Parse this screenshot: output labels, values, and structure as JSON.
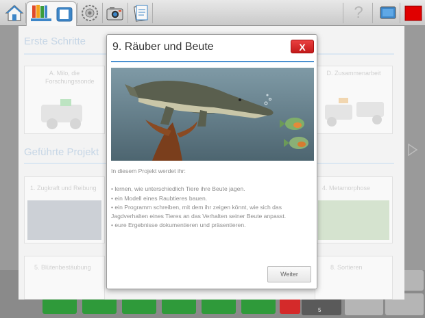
{
  "toolbar": {
    "home_icon": "home-icon",
    "projects_icon": "projects-books-icon",
    "settings_icon": "gear-icon",
    "camera_icon": "camera-icon",
    "document_icon": "document-icon",
    "help_label": "?",
    "screen_icon": "screen-icon",
    "record_icon": "record-icon"
  },
  "background": {
    "section1_title": "Erste Schritte",
    "section2_title": "Geführte Projekt",
    "cards": [
      {
        "label": "A. Milo, die Forschungssonde"
      },
      {
        "label": "D. Zusammenarbeit"
      },
      {
        "label": "1. Zugkraft und Reibung"
      },
      {
        "label": "4. Metamorphose"
      },
      {
        "label": "5. Blütenbestäubung"
      },
      {
        "label": "8. Sortieren"
      }
    ],
    "bottom_counter": "5"
  },
  "modal": {
    "title": "9. Räuber und Beute",
    "close_label": "X",
    "intro": "In diesem Projekt werdet ihr:",
    "bullets": [
      "• lernen, wie unterschiedlich Tiere ihre Beute jagen.",
      "• ein Modell eines Raubtieres bauen.",
      "• ein Programm schreiben, mit dem ihr zeigen könnt, wie sich das Jagdverhalten eines Tieres an das Verhalten seiner Beute anpasst.",
      "• eure Ergebnisse dokumentieren und präsentieren."
    ],
    "next_button": "Weiter"
  },
  "colors": {
    "accent_blue": "#4a90d0",
    "close_red": "#d42a2a",
    "record_red": "#e00000"
  }
}
